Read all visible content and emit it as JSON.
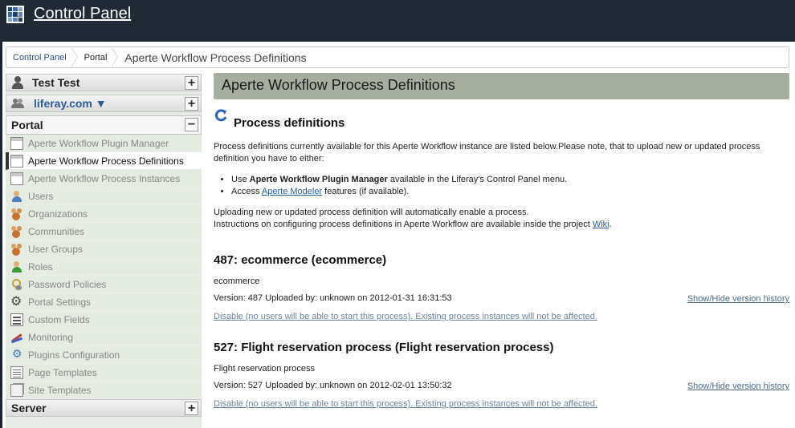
{
  "header": {
    "title": "Control Panel"
  },
  "breadcrumb": {
    "items": [
      "Control Panel",
      "Portal",
      "Aperte Workflow Process Definitions"
    ]
  },
  "sidebar": {
    "user_name": "Test Test",
    "site_name": "liferay.com ▼",
    "portal_label": "Portal",
    "items": [
      {
        "label": "Aperte Workflow Plugin Manager",
        "icon": "document-icon"
      },
      {
        "label": "Aperte Workflow Process Definitions",
        "icon": "document-icon"
      },
      {
        "label": "Aperte Workflow Process Instances",
        "icon": "document-icon"
      },
      {
        "label": "Users",
        "icon": "user-icon"
      },
      {
        "label": "Organizations",
        "icon": "organization-icon"
      },
      {
        "label": "Communities",
        "icon": "communities-icon"
      },
      {
        "label": "User Groups",
        "icon": "user-groups-icon"
      },
      {
        "label": "Roles",
        "icon": "role-icon"
      },
      {
        "label": "Password Policies",
        "icon": "key-icon"
      },
      {
        "label": "Portal Settings",
        "icon": "gear-icon"
      },
      {
        "label": "Custom Fields",
        "icon": "form-icon"
      },
      {
        "label": "Monitoring",
        "icon": "chart-icon"
      },
      {
        "label": "Plugins Configuration",
        "icon": "plugin-icon"
      },
      {
        "label": "Page Templates",
        "icon": "page-template-icon"
      },
      {
        "label": "Site Templates",
        "icon": "site-template-icon"
      }
    ],
    "server_label": "Server"
  },
  "content": {
    "portlet_title": "Aperte Workflow Process Definitions",
    "section_heading": "Process definitions",
    "intro_text": "Process definitions currently available for this Aperte Workflow instance are listed below.Please note, that to upload new or updated process definition you have to either:",
    "bullet1_prefix": "Use ",
    "bullet1_bold": "Aperte Workflow Plugin Manager",
    "bullet1_suffix": " available in the Liferay's Control Panel menu.",
    "bullet2_prefix": "Access ",
    "bullet2_link": "Aperte Modeler",
    "bullet2_suffix": " features (if available).",
    "para_line1": "Uploading new or updated process definition will automatically enable a process.",
    "para_line2_prefix": "Instructions on configuring process definitions in Aperte Workflow are available inside the project ",
    "para_line2_link": "Wiki",
    "para_line2_suffix": ".",
    "processes": [
      {
        "heading": "487: ecommerce (ecommerce)",
        "description": "ecommerce",
        "version_line": "Version: 487 Uploaded by: unknown on 2012-01-31 16:31:53",
        "history_link": "Show/Hide version history",
        "disable_link": "Disable (no users will be able to start this process). Existing process instances will not be affected."
      },
      {
        "heading": "527: Flight reservation process (Flight reservation process)",
        "description": "Flight reservation process",
        "version_line": "Version: 527 Uploaded by: unknown on 2012-02-01 13:50:32",
        "history_link": "Show/Hide version history",
        "disable_link": "Disable (no users will be able to start this process). Existing process instances will not be affected."
      }
    ]
  },
  "colors": {
    "topbar": "#1f2a35",
    "portlet_title_bg": "#a6ae9f",
    "link": "#2a5d96"
  }
}
